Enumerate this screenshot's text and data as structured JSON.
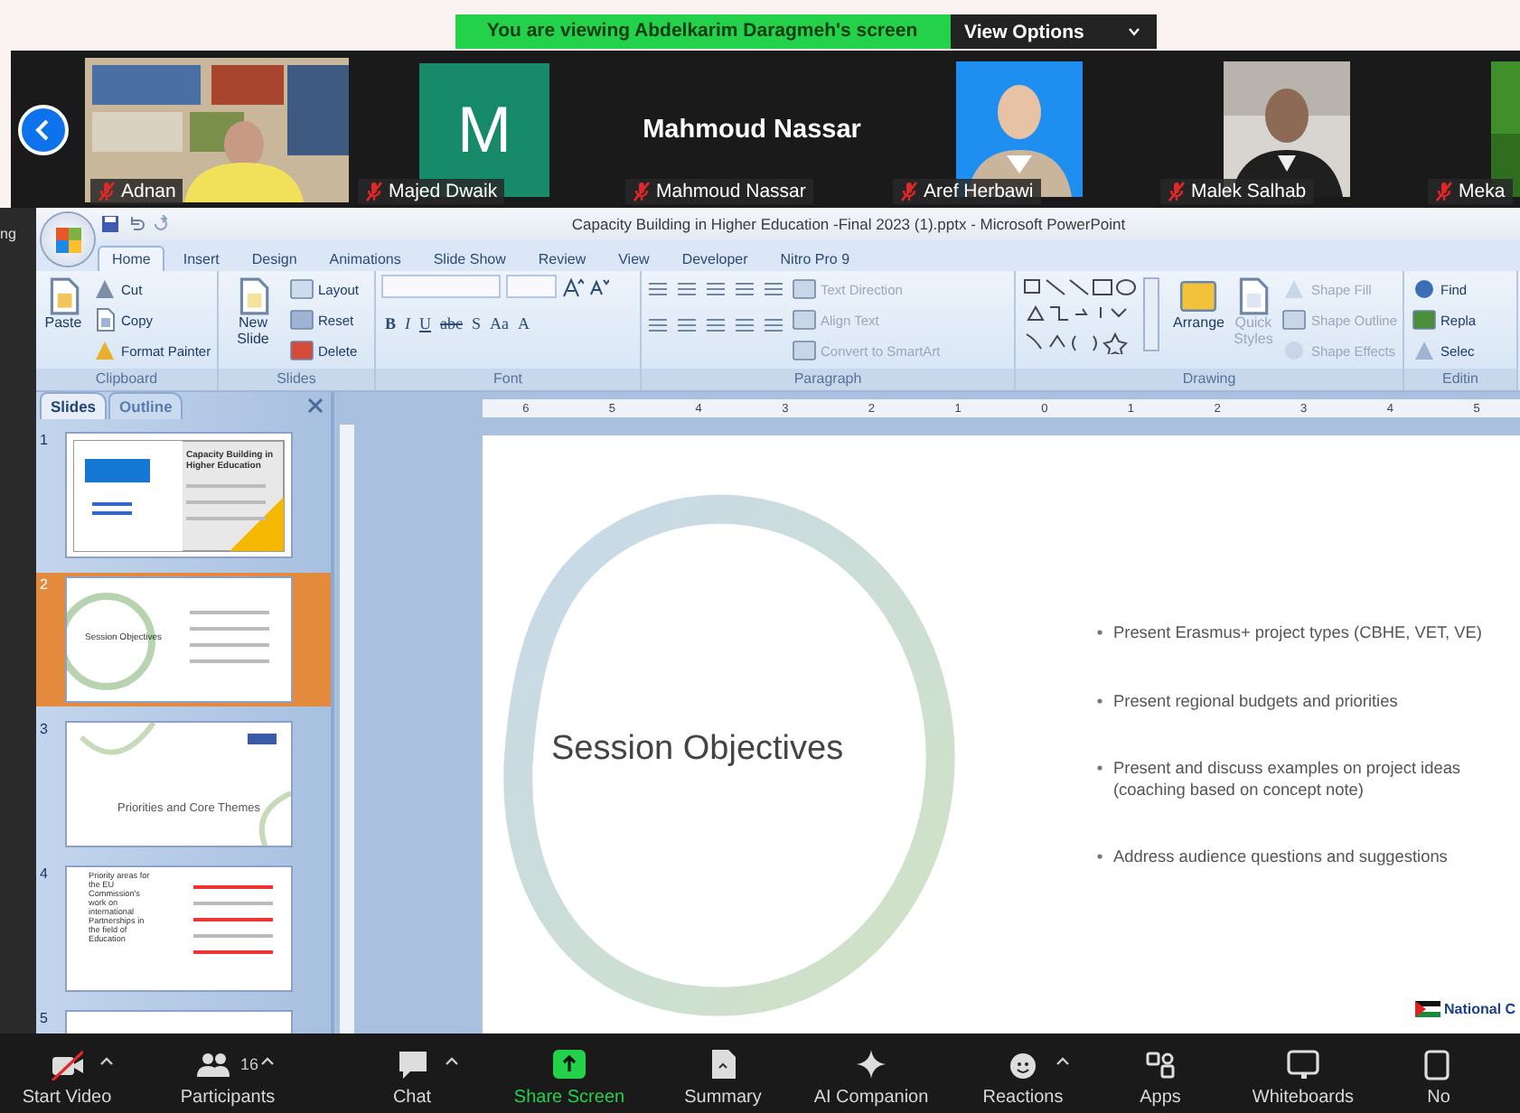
{
  "banner": {
    "text": "You are viewing Abdelkarim Daragmeh's screen",
    "button": "View Options"
  },
  "gallery": [
    {
      "name": "Adnan",
      "kind": "video",
      "muted": true
    },
    {
      "name": "Majed Dwaik",
      "kind": "initial",
      "initial": "M",
      "muted": true
    },
    {
      "name": "Mahmoud Nassar",
      "kind": "name",
      "display_name": "Mahmoud Nassar",
      "muted": true
    },
    {
      "name": "Aref Herbawi",
      "muted": true
    },
    {
      "name": "Malek Salhab",
      "muted": true
    },
    {
      "name": "Meka",
      "muted": true
    }
  ],
  "edge_text": "ng",
  "powerpoint": {
    "title": "Capacity Building in Higher Education -Final 2023 (1).pptx - Microsoft PowerPoint",
    "tabs": [
      {
        "label": "Home",
        "selected": true
      },
      {
        "label": "Insert",
        "selected": false
      },
      {
        "label": "Design",
        "selected": false
      },
      {
        "label": "Animations",
        "selected": false
      },
      {
        "label": "Slide Show",
        "selected": false
      },
      {
        "label": "Review",
        "selected": false
      },
      {
        "label": "View",
        "selected": false
      },
      {
        "label": "Developer",
        "selected": false
      },
      {
        "label": "Nitro Pro 9",
        "selected": false
      }
    ],
    "ribbon": [
      {
        "name": "Clipboard",
        "items": [
          {
            "label": "Paste",
            "kind": "large",
            "disabled": false
          },
          {
            "label": "Cut",
            "kind": "small",
            "disabled": false
          },
          {
            "label": "Copy",
            "kind": "small",
            "disabled": false
          },
          {
            "label": "Format Painter",
            "kind": "small",
            "disabled": false
          }
        ]
      },
      {
        "name": "Slides",
        "items": [
          {
            "label": "New Slide",
            "kind": "large",
            "disabled": false
          },
          {
            "label": "Layout",
            "kind": "small",
            "disabled": false
          },
          {
            "label": "Reset",
            "kind": "small",
            "disabled": false
          },
          {
            "label": "Delete",
            "kind": "small",
            "disabled": false
          }
        ]
      },
      {
        "name": "Font",
        "items": [
          {
            "kind": "fields"
          },
          {
            "kind": "format",
            "labels": [
              "B",
              "I",
              "U",
              "abc",
              "S",
              "Aa",
              "A"
            ]
          }
        ]
      },
      {
        "name": "Paragraph",
        "items": [
          {
            "kind": "paragraph"
          },
          {
            "label": "Text Direction",
            "kind": "small",
            "disabled": true
          },
          {
            "label": "Align Text",
            "kind": "small",
            "disabled": true
          },
          {
            "label": "Convert to SmartArt",
            "kind": "small",
            "disabled": true
          }
        ]
      },
      {
        "name": "Drawing",
        "items": [
          {
            "kind": "shapes"
          },
          {
            "label": "Arrange",
            "kind": "large",
            "disabled": false
          },
          {
            "label": "Quick Styles",
            "kind": "large",
            "disabled": true
          },
          {
            "label": "Shape Fill",
            "kind": "small",
            "disabled": true
          },
          {
            "label": "Shape Outline",
            "kind": "small",
            "disabled": true
          },
          {
            "label": "Shape Effects",
            "kind": "small",
            "disabled": true
          }
        ]
      },
      {
        "name": "Editin",
        "items": [
          {
            "label": "Find",
            "kind": "small",
            "disabled": false
          },
          {
            "label": "Repla",
            "kind": "small",
            "disabled": false
          },
          {
            "label": "Selec",
            "kind": "small",
            "disabled": false
          }
        ]
      }
    ],
    "pane_tabs": [
      {
        "label": "Slides",
        "selected": true
      },
      {
        "label": "Outline",
        "selected": false
      }
    ],
    "slides": [
      {
        "number": "1",
        "selected": false,
        "kind": "cover",
        "title": "Capacity Building in Higher Education"
      },
      {
        "number": "2",
        "selected": true,
        "kind": "objectives",
        "title": "Session Objectives"
      },
      {
        "number": "3",
        "selected": false,
        "kind": "section",
        "title": "Priorities and Core Themes"
      },
      {
        "number": "4",
        "selected": false,
        "kind": "list",
        "title": "Priority areas for the EU Commission's work on international Partnerships in the field of Education"
      },
      {
        "number": "5",
        "selected": false,
        "kind": "blank"
      }
    ],
    "ruler": [
      "6",
      "5",
      "4",
      "3",
      "2",
      "1",
      "0",
      "1",
      "2",
      "3",
      "4",
      "5"
    ],
    "slide": {
      "title": "Session Objectives",
      "bullets": [
        "Present Erasmus+ project types (CBHE, VET, VE)",
        "Present regional budgets and priorities",
        "Present and discuss examples on project ideas (coaching based on concept note)",
        "Address audience questions and suggestions"
      ],
      "logo": "National C"
    }
  },
  "toolbar": [
    {
      "label": "Start Video",
      "kind": "video",
      "caret": true
    },
    {
      "label": "Participants",
      "kind": "participants",
      "count": "16",
      "caret": true
    },
    {
      "label": "Chat",
      "kind": "chat",
      "caret": true
    },
    {
      "label": "Share Screen",
      "kind": "share",
      "caret": false
    },
    {
      "label": "Summary",
      "kind": "summary",
      "caret": false
    },
    {
      "label": "AI Companion",
      "kind": "ai",
      "caret": false
    },
    {
      "label": "Reactions",
      "kind": "reactions",
      "caret": true
    },
    {
      "label": "Apps",
      "kind": "apps",
      "caret": false
    },
    {
      "label": "Whiteboards",
      "kind": "whiteboard",
      "caret": false
    },
    {
      "label": "No",
      "kind": "notes",
      "caret": false
    }
  ]
}
